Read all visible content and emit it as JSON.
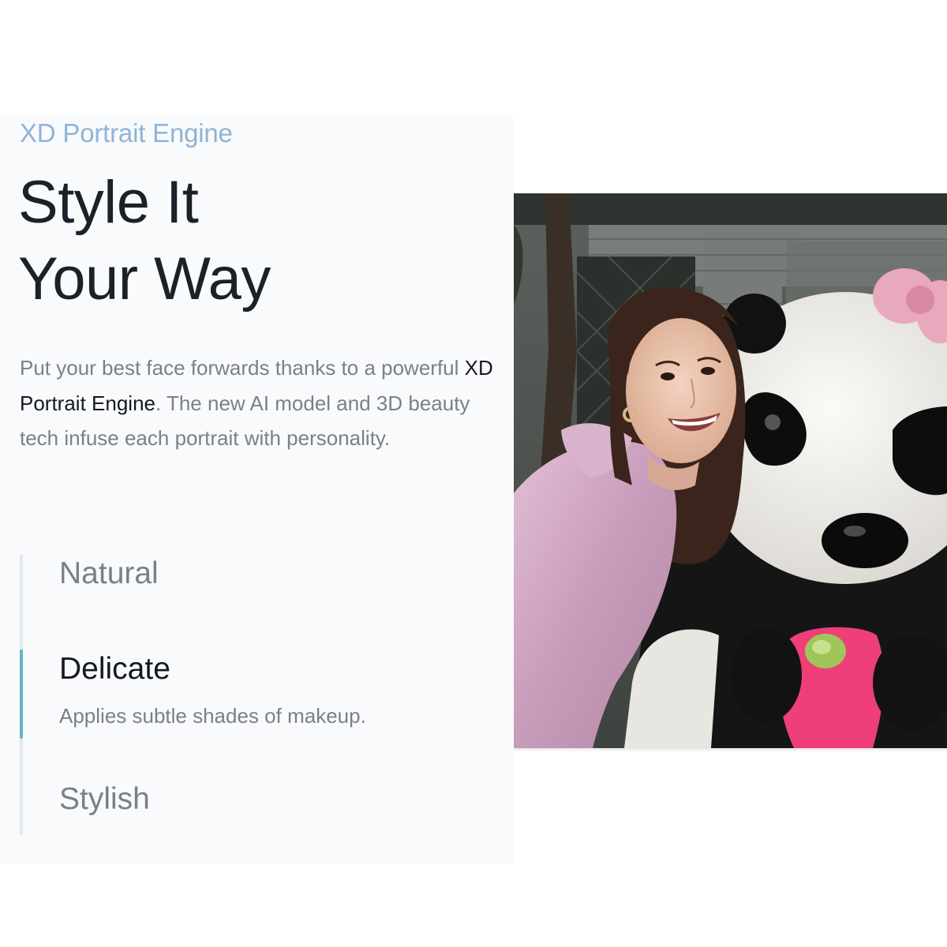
{
  "section": {
    "eyebrow": "XD Portrait Engine",
    "headline_line1": "Style It",
    "headline_line2": "Your Way",
    "description": {
      "part1": "Put your best face forwards thanks to a powerful ",
      "highlight": "XD Portrait Engine",
      "part2": ". The new AI model and 3D beauty tech infuse each portrait with personality."
    }
  },
  "styles": {
    "active_index": 1,
    "items": [
      {
        "label": "Natural",
        "description": ""
      },
      {
        "label": "Delicate",
        "description": "Applies subtle shades of makeup."
      },
      {
        "label": "Stylish",
        "description": ""
      }
    ]
  },
  "colors": {
    "eyebrow": "#8fb4d6",
    "headline": "#1b2129",
    "muted_text": "#7b8088",
    "active_indicator": "#62b4c9",
    "panel_background": "#f8fafc"
  },
  "image": {
    "subject": "portrait-photo"
  }
}
